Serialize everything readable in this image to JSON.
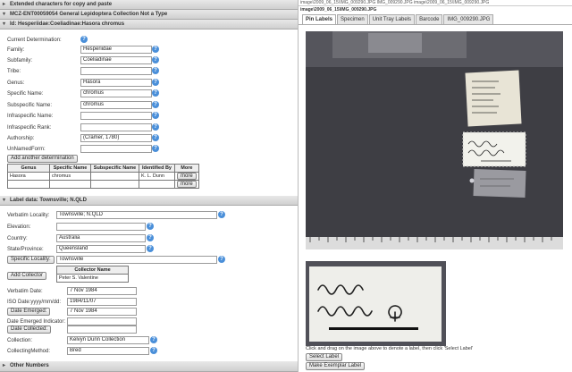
{
  "left": {
    "section_extended": "Extended characters for copy and paste",
    "catalog_header": "MCZ-ENT00059054 General Lepidoptera Collection Not a Type",
    "id_header": "Id: Hesperiidae:Coeliadinae:Hasora chromus",
    "labels": {
      "current_determination": "Current Determination:",
      "family": "Family:",
      "subfamily": "Subfamily:",
      "tribe": "Tribe:",
      "genus": "Genus:",
      "specific_name": "Specific Name:",
      "subspecific_name": "Subspecific Name:",
      "infraspecific_name": "Infraspecific Name:",
      "infraspecific_rank": "Infraspecific Rank:",
      "authorship": "Authorship:",
      "unnamed_form": "UnNamedForm:"
    },
    "values": {
      "family": "Hesperiidae",
      "subfamily": "Coeliadinae",
      "tribe": "",
      "genus": "Hasora",
      "specific_name": "chromus",
      "subspecific_name": "chromus",
      "infraspecific_name": "",
      "infraspecific_rank": "",
      "authorship": "(Cramer, 1780)",
      "unnamed_form": ""
    },
    "add_determination_button": "Add another determination",
    "det_table": {
      "headers": [
        "Genus",
        "Specific Name",
        "Subspecific Name",
        "Identified By",
        "More"
      ],
      "rows": [
        [
          "Hasora",
          "chromus",
          "",
          "K. L. Dunn",
          "more"
        ],
        [
          "",
          "",
          "",
          "",
          "more"
        ]
      ]
    },
    "label_data_header": "Label data: Townsville; N.QLD",
    "locality": {
      "verbatim_locality_label": "Verbatim Locality:",
      "verbatim_locality": "Townsville; N.QLD",
      "elevation_label": "Elevation:",
      "elevation": "",
      "country_label": "Country:",
      "country": "Australia",
      "state_label": "State/Province:",
      "state": "Queensland",
      "specific_locality_button": "Specific Locality:",
      "specific_locality": "Townsville"
    },
    "collector": {
      "add_collector_button": "Add Collector",
      "header": "Collector Name",
      "name": "Peter S. Valentine"
    },
    "dates": {
      "verbatim_date_label": "Verbatim Date:",
      "verbatim_date": "7 Nov 1984",
      "iso_date_label": "ISO Date:yyyy/mm/dd:",
      "iso_date": "1984/11/07",
      "date_emerged_button": "Date Emerged:",
      "date_emerged": "7 Nov 1984",
      "date_emerged_indicator_label": "Date Emerged Indicator:",
      "date_emerged_indicator": "",
      "date_collected_button": "Date Collected:",
      "date_collected": ""
    },
    "collection_label": "Collection:",
    "collection": "Kelvyn Dunn Collection",
    "collecting_method_label": "CollectingMethod:",
    "collecting_method": "Bred",
    "other_numbers_header": "Other Numbers"
  },
  "right": {
    "url_line1": "image\\2009_06_15\\IMG_009290.JPG   IMG_009290.JPG   image\\2009_06_15\\IMG_009290.JPG",
    "image_title": "image\\2009_06_15\\IMG_009290.JPG",
    "tabs": [
      "Pin Labels",
      "Specimen",
      "Unit Tray Labels",
      "Barcode",
      "IMG_009290.JPG"
    ],
    "help_text": "Click and drag on the image above to denote a label, then click 'Select Label'",
    "select_label_button": "Select Label",
    "make_exemplar_button": "Make Exemplar Label"
  },
  "colors": {
    "help_icon": "#4a8fd9",
    "photo_background": "#3f3f46"
  }
}
